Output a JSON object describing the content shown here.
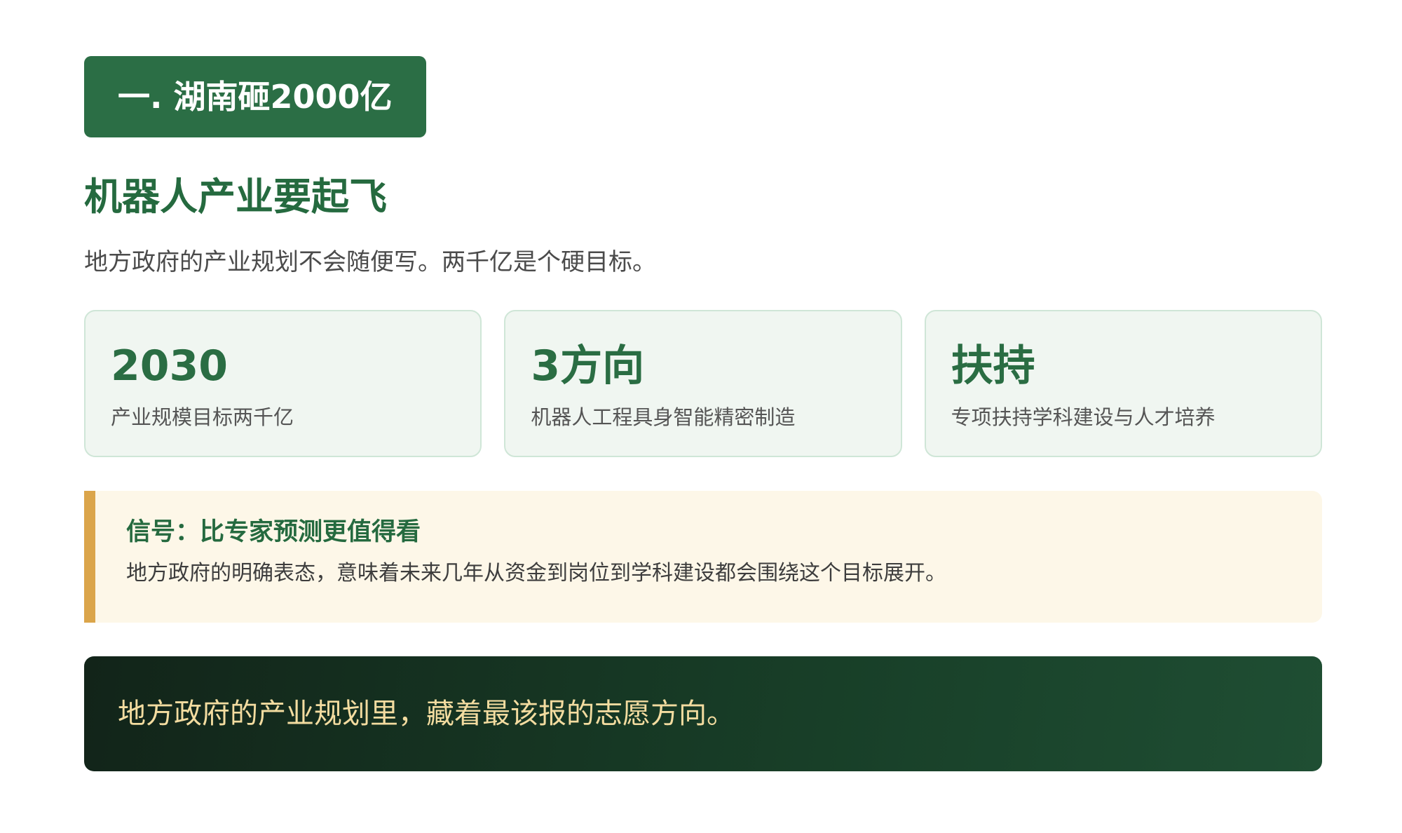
{
  "section": {
    "badge": "一. 湖南砸2000亿"
  },
  "heading": "机器人产业要起飞",
  "subtitle": "地方政府的产业规划不会随便写。两千亿是个硬目标。",
  "stats": [
    {
      "value": "2030",
      "label": "产业规模目标两千亿"
    },
    {
      "value": "3方向",
      "label": "机器人工程具身智能精密制造"
    },
    {
      "value": "扶持",
      "label": "专项扶持学科建设与人才培养"
    }
  ],
  "signal": {
    "title": "信号：比专家预测更值得看",
    "text": "地方政府的明确表态，意味着未来几年从资金到岗位到学科建设都会围绕这个目标展开。"
  },
  "closing": "地方政府的产业规划里，藏着最该报的志愿方向。",
  "colors": {
    "brand_green": "#2b6e45",
    "heading_green": "#256a3f",
    "card_bg": "#f0f6f1",
    "signal_accent": "#dba54a",
    "signal_bg": "#fdf7e8",
    "banner_text": "#f3dca0"
  }
}
